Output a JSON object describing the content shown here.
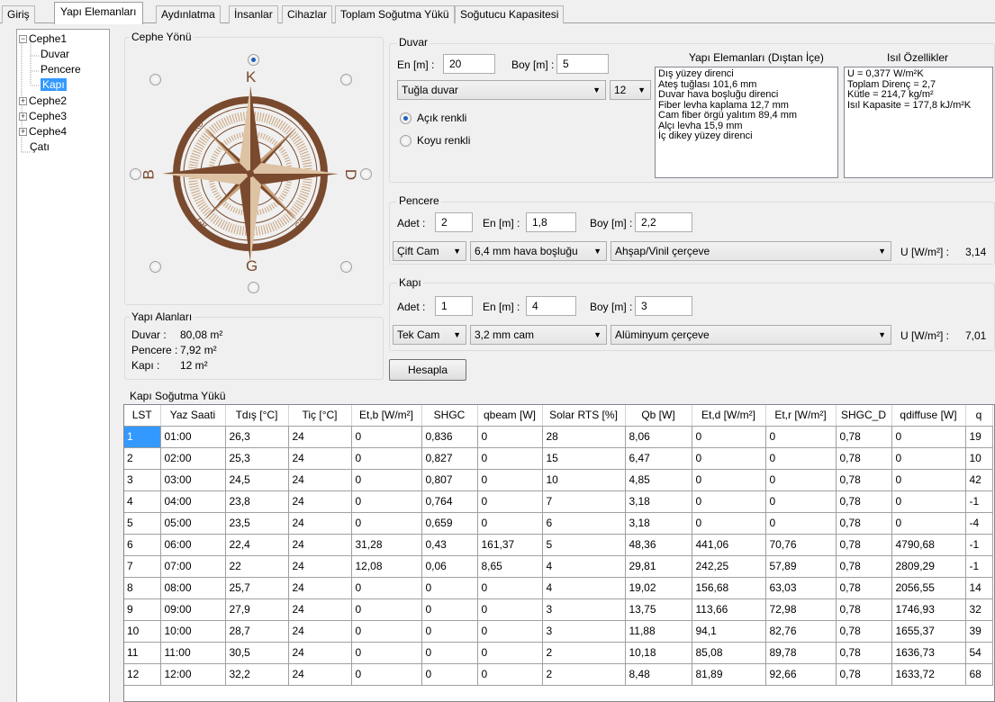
{
  "tabs": [
    "Giriş",
    "Yapı Elemanları",
    "Aydınlatma",
    "İnsanlar",
    "Cihazlar",
    "Toplam Soğutma Yükü",
    "Soğutucu Kapasitesi"
  ],
  "tree": {
    "cephe1": "Cephe1",
    "duvar": "Duvar",
    "pencere": "Pencere",
    "kapi": "Kapı",
    "cephe2": "Cephe2",
    "cephe3": "Cephe3",
    "cephe4": "Cephe4",
    "cati": "Çatı"
  },
  "cephe_yonu": {
    "title": "Cephe Yönü",
    "north": "K",
    "south": "G",
    "west": "B",
    "east": "D",
    "northwest": "KB",
    "northeast": "KD",
    "southwest": "GB",
    "southeast": "GD",
    "selected": "K"
  },
  "yapi_alanlari": {
    "title": "Yapı Alanları",
    "duvar_label": "Duvar :",
    "duvar_value": "80,08 m²",
    "pencere_label": "Pencere :",
    "pencere_value": "7,92 m²",
    "kapi_label": "Kapı :",
    "kapi_value": "12 m²"
  },
  "duvar": {
    "title": "Duvar",
    "en_label": "En [m] :",
    "en_value": "20",
    "boy_label": "Boy [m] :",
    "boy_value": "5",
    "material": "Tuğla duvar",
    "thickness": "12",
    "acik": "Açık renkli",
    "koyu": "Koyu renkli",
    "color_selected": "acik",
    "layers_title": "Yapı Elemanları (Dıştan İçe)",
    "layers": [
      "Dış yüzey direnci",
      "Ateş tuğlası 101,6 mm",
      "Duvar hava boşluğu direnci",
      "Fiber levha kaplama 12,7 mm",
      "Cam fiber örgü yalıtım 89,4 mm",
      "Alçı levha 15,9 mm",
      "İç dikey yüzey direnci"
    ],
    "props_title": "Isıl Özellikler",
    "props": [
      "U = 0,377 W/m²K",
      "Toplam Direnç = 2,7",
      "Kütle = 214,7 kg/m²",
      "Isıl Kapasite = 177,8 kJ/m²K"
    ]
  },
  "pencere": {
    "title": "Pencere",
    "adet_label": "Adet :",
    "adet_value": "2",
    "en_label": "En [m] :",
    "en_value": "1,8",
    "boy_label": "Boy [m] :",
    "boy_value": "2,2",
    "cam": "Çift Cam",
    "bosluk": "6,4 mm hava boşluğu",
    "cerceve": "Ahşap/Vinil çerçeve",
    "u_label": "U [W/m²] :",
    "u_value": "3,14"
  },
  "kapi": {
    "title": "Kapı",
    "adet_label": "Adet :",
    "adet_value": "1",
    "en_label": "En [m] :",
    "en_value": "4",
    "boy_label": "Boy [m] :",
    "boy_value": "3",
    "cam": "Tek Cam",
    "kalinlik": "3,2 mm cam",
    "cerceve": "Alüminyum çerçeve",
    "u_label": "U [W/m²] :",
    "u_value": "7,01"
  },
  "hesapla_label": "Hesapla",
  "table": {
    "title": "Kapı Soğutma Yükü",
    "columns": [
      "LST",
      "Yaz Saati",
      "Tdış [°C]",
      "Tiç [°C]",
      "Et,b [W/m²]",
      "SHGC",
      "qbeam [W]",
      "Solar RTS [%]",
      "Qb [W]",
      "Et,d [W/m²]",
      "Et,r [W/m²]",
      "SHGC_D",
      "qdiffuse [W]",
      "q"
    ],
    "rows": [
      [
        "1",
        "01:00",
        "26,3",
        "24",
        "0",
        "0,836",
        "0",
        "28",
        "8,06",
        "0",
        "0",
        "0,78",
        "0",
        "19"
      ],
      [
        "2",
        "02:00",
        "25,3",
        "24",
        "0",
        "0,827",
        "0",
        "15",
        "6,47",
        "0",
        "0",
        "0,78",
        "0",
        "10"
      ],
      [
        "3",
        "03:00",
        "24,5",
        "24",
        "0",
        "0,807",
        "0",
        "10",
        "4,85",
        "0",
        "0",
        "0,78",
        "0",
        "42"
      ],
      [
        "4",
        "04:00",
        "23,8",
        "24",
        "0",
        "0,764",
        "0",
        "7",
        "3,18",
        "0",
        "0",
        "0,78",
        "0",
        "-1"
      ],
      [
        "5",
        "05:00",
        "23,5",
        "24",
        "0",
        "0,659",
        "0",
        "6",
        "3,18",
        "0",
        "0",
        "0,78",
        "0",
        "-4"
      ],
      [
        "6",
        "06:00",
        "22,4",
        "24",
        "31,28",
        "0,43",
        "161,37",
        "5",
        "48,36",
        "441,06",
        "70,76",
        "0,78",
        "4790,68",
        "-1"
      ],
      [
        "7",
        "07:00",
        "22",
        "24",
        "12,08",
        "0,06",
        "8,65",
        "4",
        "29,81",
        "242,25",
        "57,89",
        "0,78",
        "2809,29",
        "-1"
      ],
      [
        "8",
        "08:00",
        "25,7",
        "24",
        "0",
        "0",
        "0",
        "4",
        "19,02",
        "156,68",
        "63,03",
        "0,78",
        "2056,55",
        "14"
      ],
      [
        "9",
        "09:00",
        "27,9",
        "24",
        "0",
        "0",
        "0",
        "3",
        "13,75",
        "113,66",
        "72,98",
        "0,78",
        "1746,93",
        "32"
      ],
      [
        "10",
        "10:00",
        "28,7",
        "24",
        "0",
        "0",
        "0",
        "3",
        "11,88",
        "94,1",
        "82,76",
        "0,78",
        "1655,37",
        "39"
      ],
      [
        "11",
        "11:00",
        "30,5",
        "24",
        "0",
        "0",
        "0",
        "2",
        "10,18",
        "85,08",
        "89,78",
        "0,78",
        "1636,73",
        "54"
      ],
      [
        "12",
        "12:00",
        "32,2",
        "24",
        "0",
        "0",
        "0",
        "2",
        "8,48",
        "81,89",
        "92,66",
        "0,78",
        "1633,72",
        "68"
      ]
    ]
  },
  "colors": {
    "selection": "#3399ff",
    "compass_brown": "#7a4a2e",
    "compass_tan": "#c9a27a",
    "background": "#f0f0f0"
  }
}
